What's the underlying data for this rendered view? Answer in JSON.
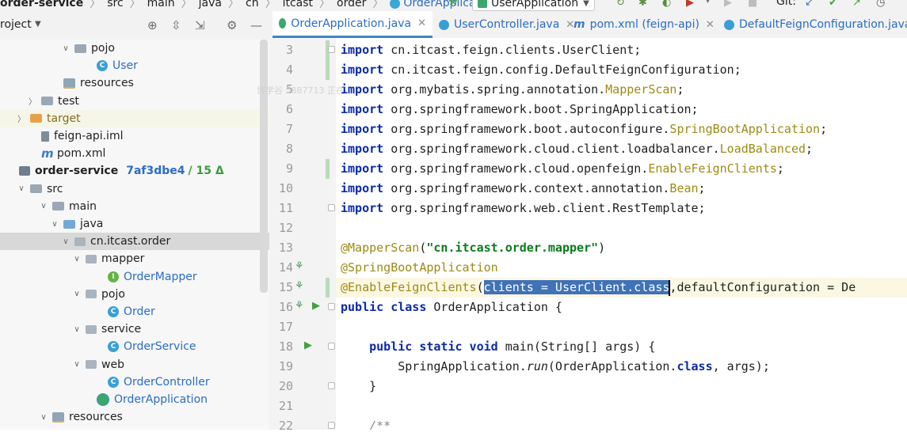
{
  "breadcrumb": {
    "items": [
      "order-service",
      "src",
      "main",
      "java",
      "cn",
      "itcast",
      "order",
      "OrderApplication"
    ]
  },
  "toolbar": {
    "run_config": "UserApplication",
    "git_label": "Git:"
  },
  "project_panel": {
    "title": "roject",
    "tree": [
      {
        "label": "pojo",
        "icon": "folder",
        "indent": 5,
        "chevron": "down"
      },
      {
        "label": "User",
        "icon": "class",
        "indent": 7,
        "chevron": ""
      },
      {
        "label": "resources",
        "icon": "resources-folder",
        "indent": 4,
        "chevron": ""
      },
      {
        "label": "test",
        "icon": "folder",
        "indent": 2,
        "chevron": "right"
      },
      {
        "label": "target",
        "icon": "folder-orange",
        "indent": 1,
        "chevron": "right"
      },
      {
        "label": "feign-api.iml",
        "icon": "iml",
        "indent": 2,
        "chevron": ""
      },
      {
        "label": "pom.xml",
        "icon": "maven",
        "indent": 2,
        "chevron": ""
      },
      {
        "label": "order-service",
        "icon": "module",
        "indent": 0,
        "chevron": "",
        "git_hash": "7af3dbe4",
        "git_count": "/ 15 Δ"
      },
      {
        "label": "src",
        "icon": "folder",
        "indent": 1,
        "chevron": "down"
      },
      {
        "label": "main",
        "icon": "folder",
        "indent": 3,
        "chevron": "down"
      },
      {
        "label": "java",
        "icon": "folder-blue",
        "indent": 4,
        "chevron": "down"
      },
      {
        "label": "cn.itcast.order",
        "icon": "package",
        "indent": 5,
        "chevron": "down"
      },
      {
        "label": "mapper",
        "icon": "package",
        "indent": 6,
        "chevron": "down"
      },
      {
        "label": "OrderMapper",
        "icon": "interface",
        "indent": 8,
        "chevron": ""
      },
      {
        "label": "pojo",
        "icon": "package",
        "indent": 6,
        "chevron": "down"
      },
      {
        "label": "Order",
        "icon": "class",
        "indent": 8,
        "chevron": ""
      },
      {
        "label": "service",
        "icon": "package",
        "indent": 6,
        "chevron": "down"
      },
      {
        "label": "OrderService",
        "icon": "class",
        "indent": 8,
        "chevron": ""
      },
      {
        "label": "web",
        "icon": "package",
        "indent": 6,
        "chevron": "down"
      },
      {
        "label": "OrderController",
        "icon": "class",
        "indent": 8,
        "chevron": ""
      },
      {
        "label": "OrderApplication",
        "icon": "spring-app",
        "indent": 7,
        "chevron": ""
      },
      {
        "label": "resources",
        "icon": "resources-folder",
        "indent": 3,
        "chevron": "down"
      }
    ]
  },
  "tabs": [
    {
      "label": "OrderApplication.java",
      "icon": "spring-app",
      "active": true
    },
    {
      "label": "UserController.java",
      "icon": "class",
      "active": false
    },
    {
      "label": "pom.xml (feign-api)",
      "icon": "maven",
      "active": false
    },
    {
      "label": "DefaultFeignConfiguration.java",
      "icon": "class",
      "active": false
    }
  ],
  "editor": {
    "line_numbers": [
      "3",
      "4",
      "5",
      "6",
      "7",
      "8",
      "9",
      "10",
      "11",
      "12",
      "13",
      "14",
      "15",
      "16",
      "17",
      "18",
      "19",
      "20",
      "21",
      "22"
    ],
    "imports": {
      "keyword": "import",
      "l3": " cn.itcast.feign.clients.UserClient;",
      "l4": " cn.itcast.feign.config.DefaultFeignConfiguration;",
      "l5_pre": " org.mybatis.spring.annotation.",
      "l5_ann": "MapperScan",
      "l6": " org.springframework.boot.SpringApplication;",
      "l7_pre": " org.springframework.boot.autoconfigure.",
      "l7_ann": "SpringBootApplication",
      "l8_pre": " org.springframework.cloud.client.loadbalancer.",
      "l8_ann": "LoadBalanced",
      "l9_pre": " org.springframework.cloud.openfeign.",
      "l9_ann": "EnableFeignClients",
      "l10_pre": " org.springframework.context.annotation.",
      "l10_ann": "Bean",
      "l11": " org.springframework.web.client.RestTemplate;",
      "semicolon": ";"
    },
    "l13_ann": "@MapperScan",
    "l13_open": "(",
    "l13_str": "\"cn.itcast.order.mapper\"",
    "l13_close": ")",
    "l14": "@SpringBootApplication",
    "l15_ann": "@EnableFeignClients",
    "l15_open": "(",
    "l15_sel": "clients = UserClient.class",
    "l15_rest": ",defaultConfiguration = De",
    "l16_kw": "public class",
    "l16_rest": " OrderApplication {",
    "l18_kw": "public static void",
    "l18_rest": " main(String[] args) {",
    "l19_pre": "SpringApplication.",
    "l19_run": "run",
    "l19_mid": "(OrderApplication.",
    "l19_kw": "class",
    "l19_end": ", args);",
    "l20": "}",
    "l22": "/**"
  },
  "watermark": "博学谷 5887713 正在"
}
